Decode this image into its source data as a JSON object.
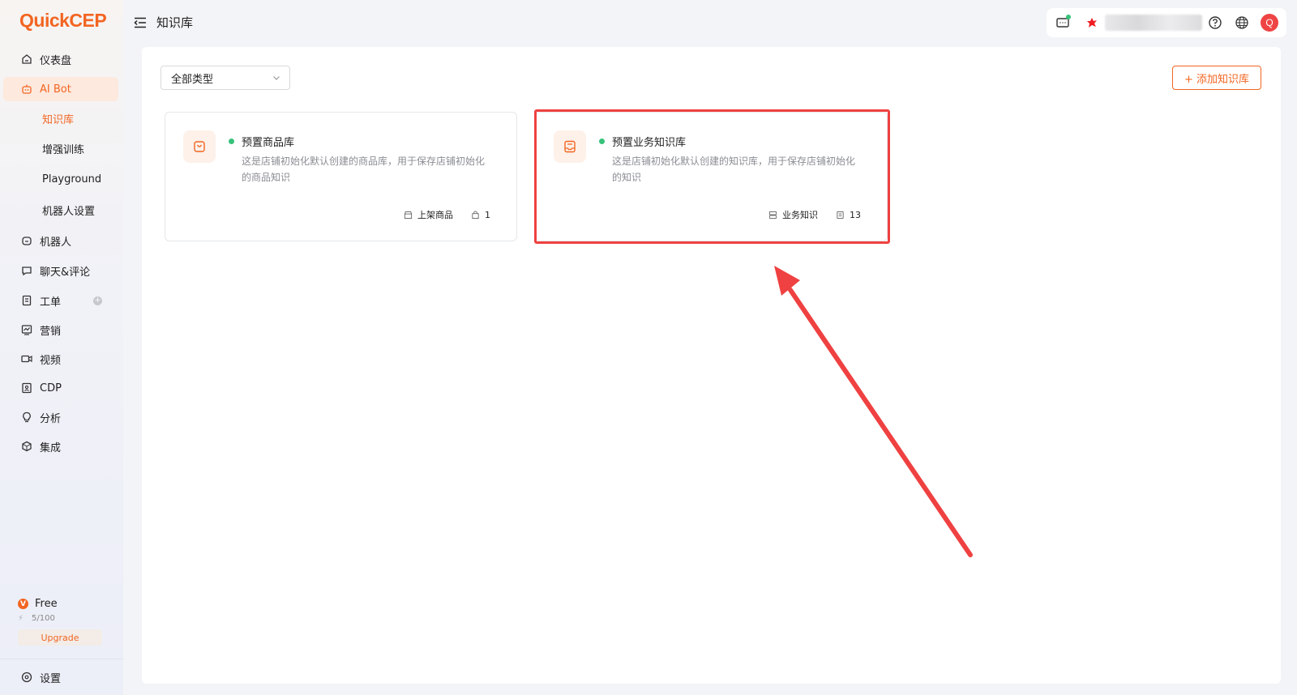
{
  "app": {
    "logo": "QuickCEP"
  },
  "sidebar": {
    "items": [
      {
        "label": "仪表盘",
        "icon": "home-icon"
      },
      {
        "label": "AI Bot",
        "icon": "bot-icon",
        "active": true
      },
      {
        "label": "机器人",
        "icon": "robot-icon"
      },
      {
        "label": "聊天&评论",
        "icon": "chat-icon"
      },
      {
        "label": "工单",
        "icon": "ticket-icon",
        "badge": "+"
      },
      {
        "label": "营销",
        "icon": "marketing-icon"
      },
      {
        "label": "视频",
        "icon": "video-icon"
      },
      {
        "label": "CDP",
        "icon": "cdp-icon"
      },
      {
        "label": "分析",
        "icon": "bulb-icon"
      },
      {
        "label": "集成",
        "icon": "integration-icon"
      }
    ],
    "subitems": [
      {
        "label": "知识库",
        "active": true
      },
      {
        "label": "增强训练"
      },
      {
        "label": "Playground"
      },
      {
        "label": "机器人设置"
      }
    ],
    "plan": {
      "badge": "V",
      "name": "Free",
      "usage": "5/100",
      "upgrade_label": "Upgrade"
    },
    "settings_label": "设置"
  },
  "header": {
    "title": "知识库"
  },
  "toolbar": {
    "filter_value": "全部类型",
    "add_label": "+ 添加知识库"
  },
  "cards": [
    {
      "title": "预置商品库",
      "description": "这是店铺初始化默认创建的商品库，用于保存店铺初始化的商品知识",
      "meta_type": "上架商品",
      "meta_count": "1"
    },
    {
      "title": "预置业务知识库",
      "description": "这是店铺初始化默认创建的知识库，用于保存店铺初始化的知识",
      "meta_type": "业务知识",
      "meta_count": "13"
    }
  ],
  "colors": {
    "accent": "#f26522",
    "status_green": "#37c27a",
    "annotation_red": "#ef4141"
  }
}
